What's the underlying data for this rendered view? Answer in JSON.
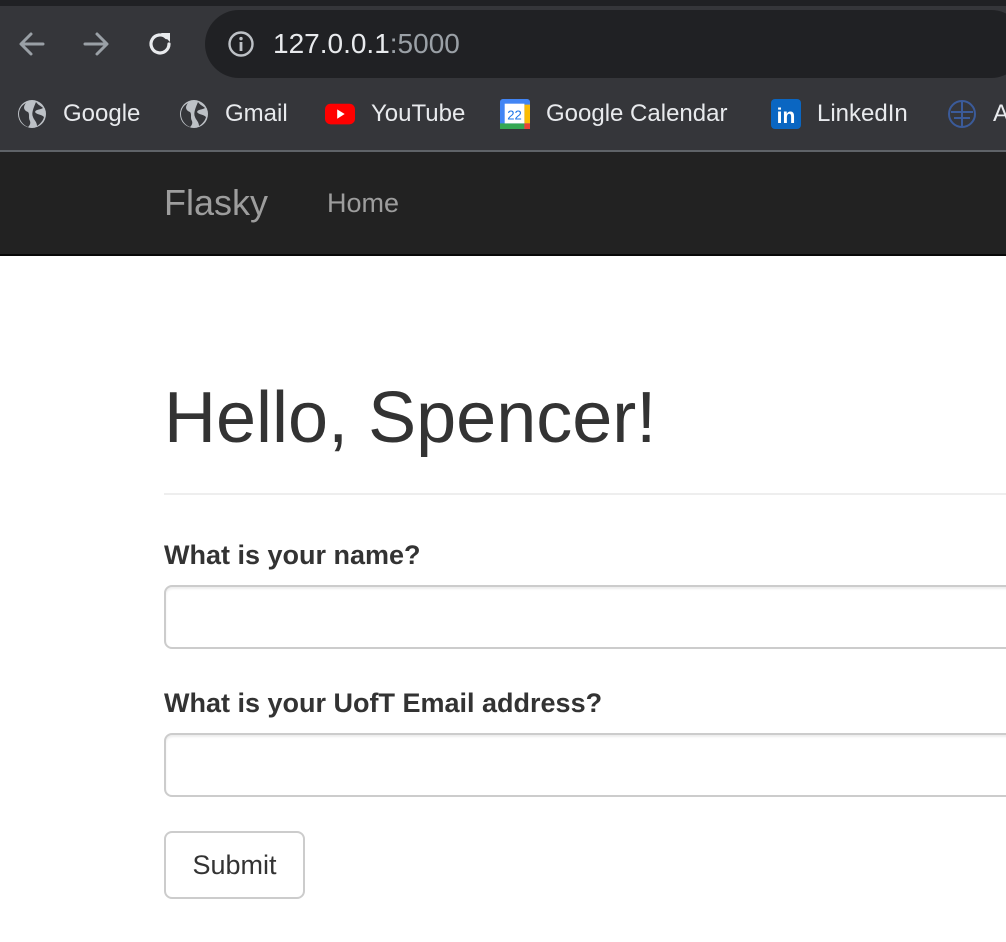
{
  "browser": {
    "url_host": "127.0.0.1",
    "url_port": ":5000",
    "bookmarks": [
      {
        "label": "Google",
        "icon": "globe-icon"
      },
      {
        "label": "Gmail",
        "icon": "globe-icon"
      },
      {
        "label": "YouTube",
        "icon": "youtube-icon"
      },
      {
        "label": "Google Calendar",
        "icon": "google-calendar-icon",
        "icon_text": "22"
      },
      {
        "label": "LinkedIn",
        "icon": "linkedin-icon",
        "icon_text": "in"
      },
      {
        "label": "A",
        "icon": "globe-icon"
      }
    ],
    "colors": {
      "chrome_bg": "#35363a",
      "omnibox_bg": "#202124",
      "text": "#e8eaed",
      "youtube_red": "#ff0000",
      "linkedin_blue": "#0a66c2"
    }
  },
  "navbar": {
    "brand": "Flasky",
    "items": [
      {
        "label": "Home"
      }
    ]
  },
  "main": {
    "heading": "Hello, Spencer!",
    "form": {
      "name_label": "What is your name?",
      "name_value": "",
      "email_label": "What is your UofT Email address?",
      "email_value": "",
      "submit_label": "Submit"
    }
  }
}
